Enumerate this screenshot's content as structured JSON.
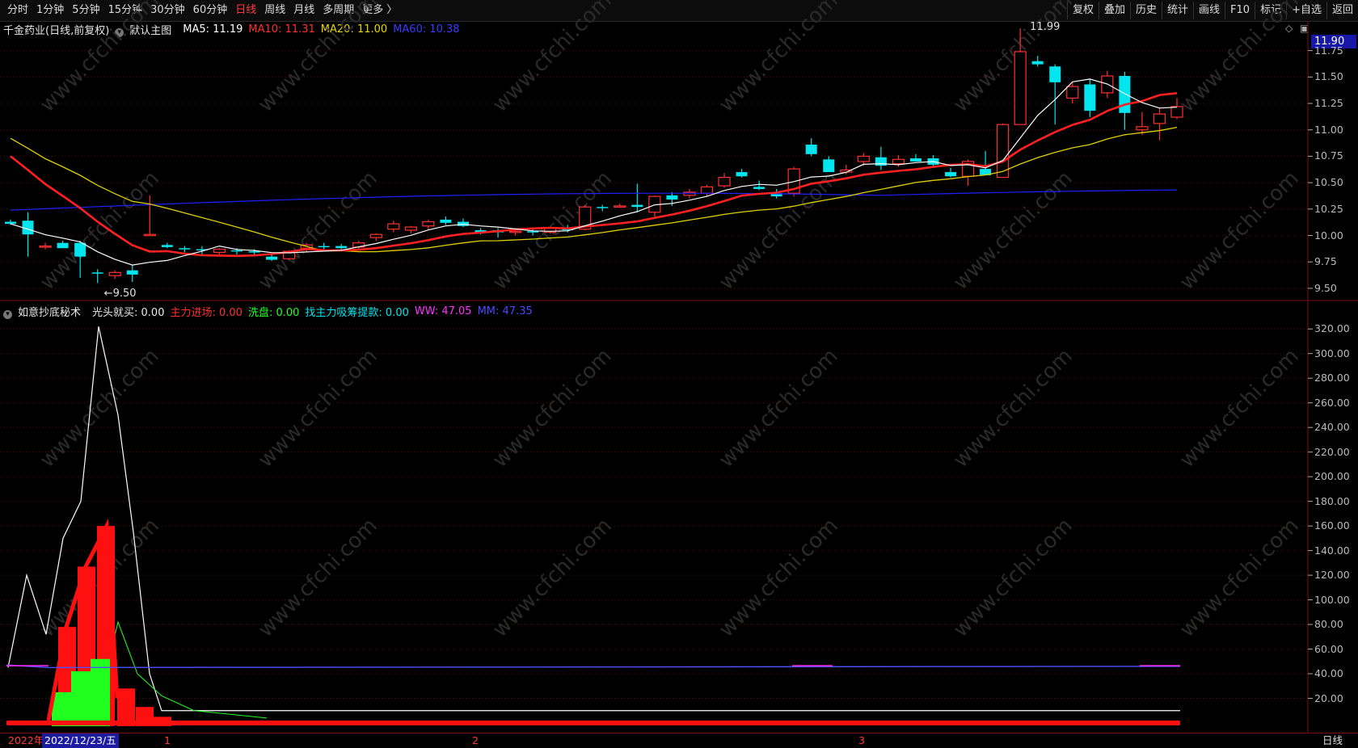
{
  "toolbar": {
    "periods": [
      "分时",
      "1分钟",
      "5分钟",
      "15分钟",
      "30分钟",
      "60分钟",
      "日线",
      "周线",
      "月线",
      "多周期",
      "更多 〉"
    ],
    "active_period": "日线",
    "right_buttons": [
      "复权",
      "叠加",
      "历史",
      "统计",
      "画线",
      "F10",
      "标记",
      "+自选",
      "返回"
    ]
  },
  "main_legend": {
    "stock_name": "千金药业(日线,前复权)",
    "template": "默认主图",
    "ma5": "MA5: 11.19",
    "ma10": "MA10: 11.31",
    "ma20": "MA20: 11.00",
    "ma60": "MA60: 10.38"
  },
  "sub_legend": {
    "title": "如意抄底秘术",
    "gtjm": "光头就买: 0.00",
    "zljc": "主力进场: 0.00",
    "xp": "洗盘: 0.00",
    "zztk": "找主力吸筹提款: 0.00",
    "ww": "WW: 47.05",
    "mm": "MM: 47.35"
  },
  "current_price_tag": "11.90",
  "price_axis": [
    "11.75",
    "11.50",
    "11.25",
    "11.00",
    "10.75",
    "10.50",
    "10.25",
    "10.00",
    "9.75",
    "9.50"
  ],
  "sub_axis": [
    "320.00",
    "300.00",
    "280.00",
    "260.00",
    "240.00",
    "220.00",
    "200.00",
    "180.00",
    "160.00",
    "140.00",
    "120.00",
    "100.00",
    "80.00",
    "60.00",
    "40.00",
    "20.00"
  ],
  "annotations": {
    "high": "11.99",
    "low": "9.50"
  },
  "bottom": {
    "year": "2022年",
    "date": "2022/12/23/五",
    "months": [
      "1",
      "2",
      "3"
    ],
    "period_label": "日线"
  },
  "watermark": "www.cfchi.com",
  "colors": {
    "up": "#ff3030",
    "down": "#00e5ee",
    "ma5": "#ffffff",
    "ma10": "#ff2020",
    "ma20": "#e0d000",
    "ma60": "#2020ff"
  }
}
